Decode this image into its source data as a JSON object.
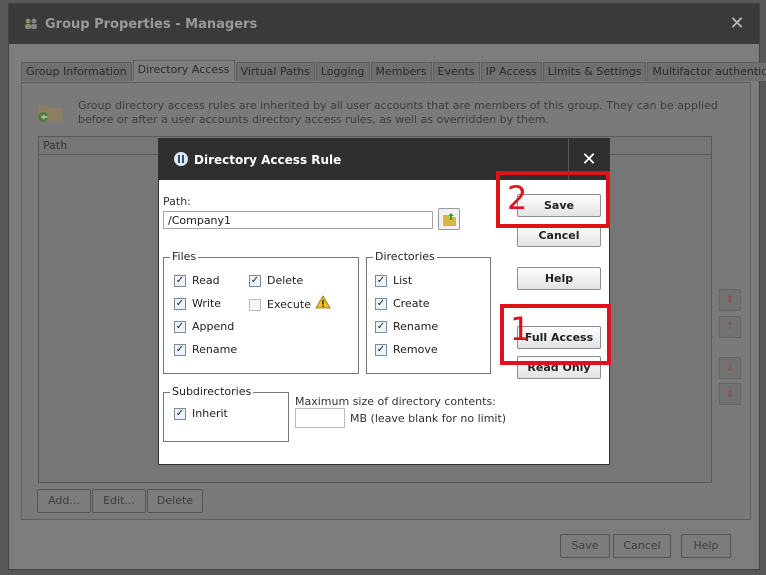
{
  "window": {
    "title": "Group Properties - Managers",
    "close_glyph": "✕"
  },
  "tabs": [
    {
      "label": "Group Information",
      "active": false
    },
    {
      "label": "Directory Access",
      "active": true
    },
    {
      "label": "Virtual Paths",
      "active": false
    },
    {
      "label": "Logging",
      "active": false
    },
    {
      "label": "Members",
      "active": false
    },
    {
      "label": "Events",
      "active": false
    },
    {
      "label": "IP Access",
      "active": false
    },
    {
      "label": "Limits & Settings",
      "active": false
    },
    {
      "label": "Multifactor authentication",
      "active": false
    }
  ],
  "panel": {
    "info_text": "Group directory access rules are inherited by all user accounts that are members of this group. They can be applied before or after a user accounts directory access rules, as well as overridden by them.",
    "table_header_path": "Path",
    "add_label": "Add...",
    "edit_label": "Edit...",
    "delete_label": "Delete"
  },
  "footer": {
    "save_label": "Save",
    "cancel_label": "Cancel",
    "help_label": "Help"
  },
  "dialog": {
    "title": "Directory Access Rule",
    "close_glyph": "✕",
    "path_label": "Path:",
    "path_value": "/Company1",
    "files": {
      "legend": "Files",
      "read": {
        "label": "Read",
        "checked": true
      },
      "write": {
        "label": "Write",
        "checked": true
      },
      "append": {
        "label": "Append",
        "checked": true
      },
      "rename": {
        "label": "Rename",
        "checked": true
      },
      "delete": {
        "label": "Delete",
        "checked": true
      },
      "execute": {
        "label": "Execute",
        "checked": false
      }
    },
    "directories": {
      "legend": "Directories",
      "list": {
        "label": "List",
        "checked": true
      },
      "create": {
        "label": "Create",
        "checked": true
      },
      "rename": {
        "label": "Rename",
        "checked": true
      },
      "remove": {
        "label": "Remove",
        "checked": true
      }
    },
    "subdirectories": {
      "legend": "Subdirectories",
      "inherit": {
        "label": "Inherit",
        "checked": true
      }
    },
    "max_size_label": "Maximum size of directory contents:",
    "max_size_value": "",
    "max_size_unit": "MB (leave blank for no limit)",
    "buttons": {
      "save": "Save",
      "cancel": "Cancel",
      "help": "Help",
      "full_access": "Full Access",
      "read_only": "Read Only"
    }
  },
  "annotations": {
    "step1": "1",
    "step2": "2",
    "color": "#e0101d"
  }
}
